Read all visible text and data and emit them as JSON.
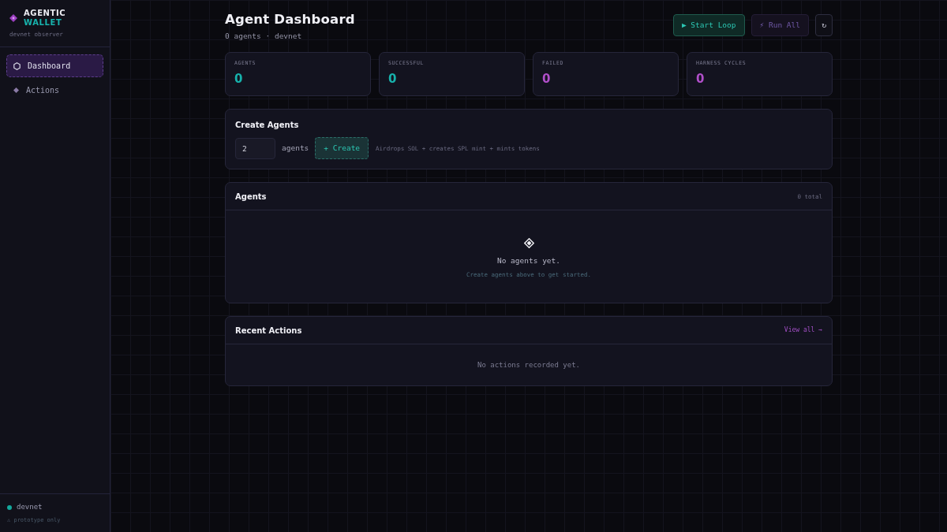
{
  "sidebar": {
    "brand": {
      "line_1": "AGENTIC",
      "line_2": "WALLET"
    },
    "subtitle": "devnet observer",
    "nav": [
      {
        "label": "Dashboard",
        "selected": true
      },
      {
        "label": "Actions",
        "selected": false
      }
    ],
    "footer": {
      "network": {
        "label": "devnet",
        "color": "#14a89c"
      },
      "note": "⚠ prototype only"
    }
  },
  "header": {
    "title": "Agent Dashboard",
    "subtitle": "0 agents · devnet",
    "buttons": [
      {
        "label": "▶ Start Loop",
        "kind": "primary",
        "disabled": false
      },
      {
        "label": "⚡ Run All",
        "kind": "secondary",
        "disabled": true
      },
      {
        "label": "↻",
        "kind": "icon",
        "disabled": false
      }
    ]
  },
  "stats": [
    {
      "label": "AGENTS",
      "value": "0",
      "color": "#17b2ac"
    },
    {
      "label": "SUCCESSFUL",
      "value": "0",
      "color": "#17b2ac"
    },
    {
      "label": "FAILED",
      "value": "0",
      "color": "#b04fc9"
    },
    {
      "label": "HARNESS CYCLES",
      "value": "0",
      "color": "#b04fc9"
    }
  ],
  "create_agents": {
    "title": "Create Agents",
    "count": "2",
    "unit": "agents",
    "button": "+ Create",
    "hint": "Airdrops SOL + creates SPL mint + mints tokens"
  },
  "agents_panel": {
    "title": "Agents",
    "count": "0 total",
    "empty_title": "No agents yet.",
    "empty_hint": "Create agents above to get started."
  },
  "recent_actions": {
    "title": "Recent Actions",
    "link": "View all →",
    "empty": "No actions recorded yet."
  }
}
